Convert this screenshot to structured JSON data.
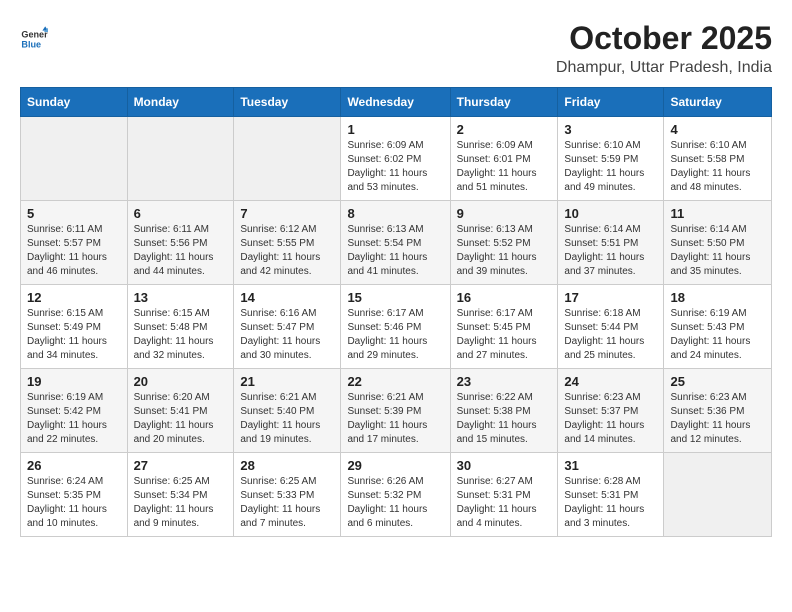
{
  "header": {
    "logo_general": "General",
    "logo_blue": "Blue",
    "month_title": "October 2025",
    "location": "Dhampur, Uttar Pradesh, India"
  },
  "weekdays": [
    "Sunday",
    "Monday",
    "Tuesday",
    "Wednesday",
    "Thursday",
    "Friday",
    "Saturday"
  ],
  "weeks": [
    [
      {
        "day": "",
        "sunrise": "",
        "sunset": "",
        "daylight": ""
      },
      {
        "day": "",
        "sunrise": "",
        "sunset": "",
        "daylight": ""
      },
      {
        "day": "",
        "sunrise": "",
        "sunset": "",
        "daylight": ""
      },
      {
        "day": "1",
        "sunrise": "Sunrise: 6:09 AM",
        "sunset": "Sunset: 6:02 PM",
        "daylight": "Daylight: 11 hours and 53 minutes."
      },
      {
        "day": "2",
        "sunrise": "Sunrise: 6:09 AM",
        "sunset": "Sunset: 6:01 PM",
        "daylight": "Daylight: 11 hours and 51 minutes."
      },
      {
        "day": "3",
        "sunrise": "Sunrise: 6:10 AM",
        "sunset": "Sunset: 5:59 PM",
        "daylight": "Daylight: 11 hours and 49 minutes."
      },
      {
        "day": "4",
        "sunrise": "Sunrise: 6:10 AM",
        "sunset": "Sunset: 5:58 PM",
        "daylight": "Daylight: 11 hours and 48 minutes."
      }
    ],
    [
      {
        "day": "5",
        "sunrise": "Sunrise: 6:11 AM",
        "sunset": "Sunset: 5:57 PM",
        "daylight": "Daylight: 11 hours and 46 minutes."
      },
      {
        "day": "6",
        "sunrise": "Sunrise: 6:11 AM",
        "sunset": "Sunset: 5:56 PM",
        "daylight": "Daylight: 11 hours and 44 minutes."
      },
      {
        "day": "7",
        "sunrise": "Sunrise: 6:12 AM",
        "sunset": "Sunset: 5:55 PM",
        "daylight": "Daylight: 11 hours and 42 minutes."
      },
      {
        "day": "8",
        "sunrise": "Sunrise: 6:13 AM",
        "sunset": "Sunset: 5:54 PM",
        "daylight": "Daylight: 11 hours and 41 minutes."
      },
      {
        "day": "9",
        "sunrise": "Sunrise: 6:13 AM",
        "sunset": "Sunset: 5:52 PM",
        "daylight": "Daylight: 11 hours and 39 minutes."
      },
      {
        "day": "10",
        "sunrise": "Sunrise: 6:14 AM",
        "sunset": "Sunset: 5:51 PM",
        "daylight": "Daylight: 11 hours and 37 minutes."
      },
      {
        "day": "11",
        "sunrise": "Sunrise: 6:14 AM",
        "sunset": "Sunset: 5:50 PM",
        "daylight": "Daylight: 11 hours and 35 minutes."
      }
    ],
    [
      {
        "day": "12",
        "sunrise": "Sunrise: 6:15 AM",
        "sunset": "Sunset: 5:49 PM",
        "daylight": "Daylight: 11 hours and 34 minutes."
      },
      {
        "day": "13",
        "sunrise": "Sunrise: 6:15 AM",
        "sunset": "Sunset: 5:48 PM",
        "daylight": "Daylight: 11 hours and 32 minutes."
      },
      {
        "day": "14",
        "sunrise": "Sunrise: 6:16 AM",
        "sunset": "Sunset: 5:47 PM",
        "daylight": "Daylight: 11 hours and 30 minutes."
      },
      {
        "day": "15",
        "sunrise": "Sunrise: 6:17 AM",
        "sunset": "Sunset: 5:46 PM",
        "daylight": "Daylight: 11 hours and 29 minutes."
      },
      {
        "day": "16",
        "sunrise": "Sunrise: 6:17 AM",
        "sunset": "Sunset: 5:45 PM",
        "daylight": "Daylight: 11 hours and 27 minutes."
      },
      {
        "day": "17",
        "sunrise": "Sunrise: 6:18 AM",
        "sunset": "Sunset: 5:44 PM",
        "daylight": "Daylight: 11 hours and 25 minutes."
      },
      {
        "day": "18",
        "sunrise": "Sunrise: 6:19 AM",
        "sunset": "Sunset: 5:43 PM",
        "daylight": "Daylight: 11 hours and 24 minutes."
      }
    ],
    [
      {
        "day": "19",
        "sunrise": "Sunrise: 6:19 AM",
        "sunset": "Sunset: 5:42 PM",
        "daylight": "Daylight: 11 hours and 22 minutes."
      },
      {
        "day": "20",
        "sunrise": "Sunrise: 6:20 AM",
        "sunset": "Sunset: 5:41 PM",
        "daylight": "Daylight: 11 hours and 20 minutes."
      },
      {
        "day": "21",
        "sunrise": "Sunrise: 6:21 AM",
        "sunset": "Sunset: 5:40 PM",
        "daylight": "Daylight: 11 hours and 19 minutes."
      },
      {
        "day": "22",
        "sunrise": "Sunrise: 6:21 AM",
        "sunset": "Sunset: 5:39 PM",
        "daylight": "Daylight: 11 hours and 17 minutes."
      },
      {
        "day": "23",
        "sunrise": "Sunrise: 6:22 AM",
        "sunset": "Sunset: 5:38 PM",
        "daylight": "Daylight: 11 hours and 15 minutes."
      },
      {
        "day": "24",
        "sunrise": "Sunrise: 6:23 AM",
        "sunset": "Sunset: 5:37 PM",
        "daylight": "Daylight: 11 hours and 14 minutes."
      },
      {
        "day": "25",
        "sunrise": "Sunrise: 6:23 AM",
        "sunset": "Sunset: 5:36 PM",
        "daylight": "Daylight: 11 hours and 12 minutes."
      }
    ],
    [
      {
        "day": "26",
        "sunrise": "Sunrise: 6:24 AM",
        "sunset": "Sunset: 5:35 PM",
        "daylight": "Daylight: 11 hours and 10 minutes."
      },
      {
        "day": "27",
        "sunrise": "Sunrise: 6:25 AM",
        "sunset": "Sunset: 5:34 PM",
        "daylight": "Daylight: 11 hours and 9 minutes."
      },
      {
        "day": "28",
        "sunrise": "Sunrise: 6:25 AM",
        "sunset": "Sunset: 5:33 PM",
        "daylight": "Daylight: 11 hours and 7 minutes."
      },
      {
        "day": "29",
        "sunrise": "Sunrise: 6:26 AM",
        "sunset": "Sunset: 5:32 PM",
        "daylight": "Daylight: 11 hours and 6 minutes."
      },
      {
        "day": "30",
        "sunrise": "Sunrise: 6:27 AM",
        "sunset": "Sunset: 5:31 PM",
        "daylight": "Daylight: 11 hours and 4 minutes."
      },
      {
        "day": "31",
        "sunrise": "Sunrise: 6:28 AM",
        "sunset": "Sunset: 5:31 PM",
        "daylight": "Daylight: 11 hours and 3 minutes."
      },
      {
        "day": "",
        "sunrise": "",
        "sunset": "",
        "daylight": ""
      }
    ]
  ]
}
